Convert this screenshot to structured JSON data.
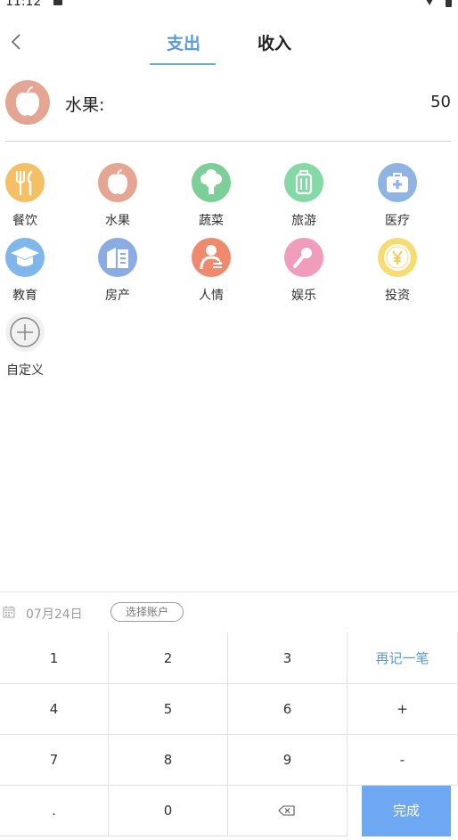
{
  "status_bar": {
    "time": "11:12"
  },
  "tabs": {
    "expense": "支出",
    "income": "收入"
  },
  "selected": {
    "name": "水果:",
    "amount": "50"
  },
  "categories": [
    {
      "label": "餐饮",
      "icon": "fork-knife-icon",
      "color": "#f5bf66"
    },
    {
      "label": "水果",
      "icon": "apple-icon",
      "color": "#e4a592"
    },
    {
      "label": "蔬菜",
      "icon": "broccoli-icon",
      "color": "#7ccf98"
    },
    {
      "label": "旅游",
      "icon": "luggage-icon",
      "color": "#85d9a6"
    },
    {
      "label": "医疗",
      "icon": "medical-kit-icon",
      "color": "#8fb3e2"
    },
    {
      "label": "教育",
      "icon": "graduation-cap-icon",
      "color": "#7fb6ec"
    },
    {
      "label": "房产",
      "icon": "building-icon",
      "color": "#8bace3"
    },
    {
      "label": "人情",
      "icon": "person-icon",
      "color": "#ef8a6e"
    },
    {
      "label": "娱乐",
      "icon": "microphone-icon",
      "color": "#ef9dbb"
    },
    {
      "label": "投资",
      "icon": "yen-coin-icon",
      "color": "#f6dc73"
    },
    {
      "label": "自定义",
      "icon": "plus-circle-icon",
      "color": "#f1f1f1"
    }
  ],
  "entry_bar": {
    "date": "07月24日",
    "account": "选择账户"
  },
  "keypad": {
    "k1": "1",
    "k2": "2",
    "k3": "3",
    "again": "再记一笔",
    "k4": "4",
    "k5": "5",
    "k6": "6",
    "plus": "+",
    "k7": "7",
    "k8": "8",
    "k9": "9",
    "minus": "-",
    "dot": ".",
    "k0": "0",
    "done": "完成"
  },
  "colors": {
    "accent": "#5b9bd5",
    "done_button": "#6ea8f3"
  }
}
